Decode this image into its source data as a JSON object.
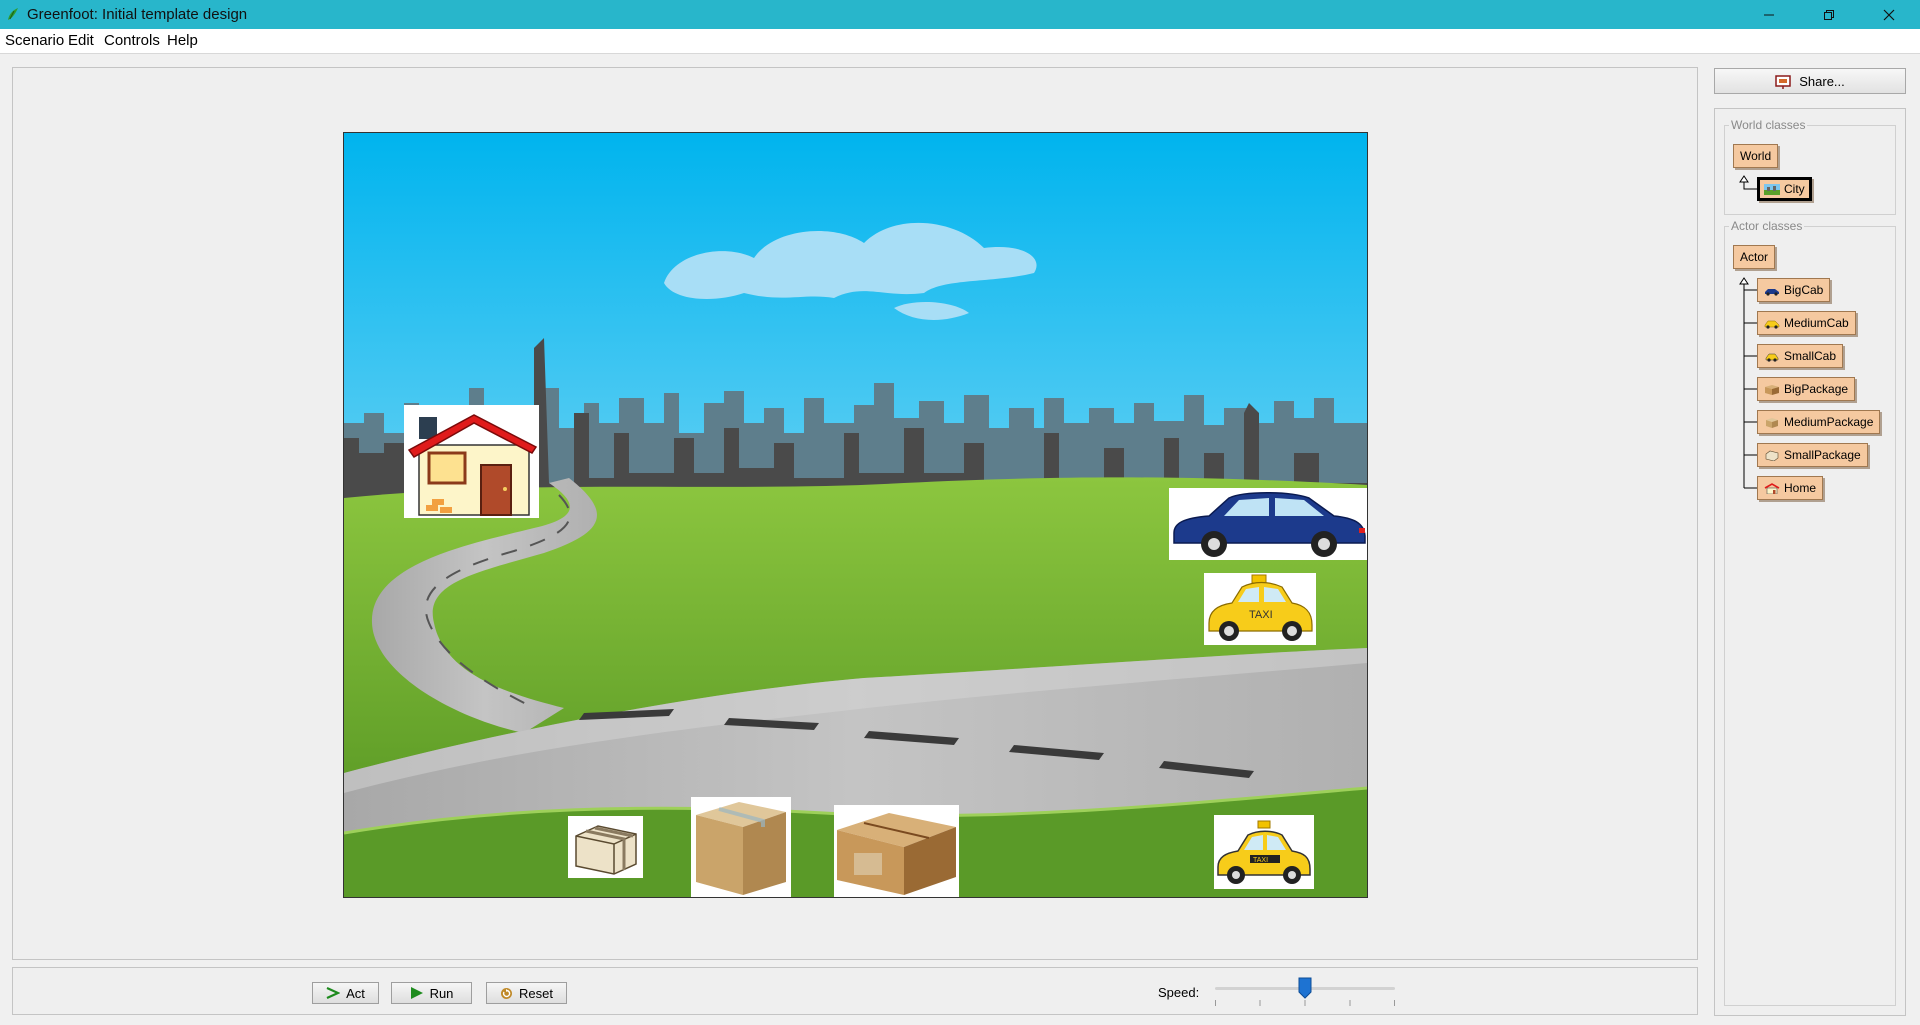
{
  "window": {
    "title": "Greenfoot: Initial template design",
    "accent_color": "#28b6cb"
  },
  "menu": [
    "Scenario",
    "Edit",
    "Controls",
    "Help"
  ],
  "world": {
    "background_icon": "city-skyline-road-scene",
    "actors": [
      {
        "name": "house-actor",
        "icon": "house-icon"
      },
      {
        "name": "blue-car-actor",
        "icon": "blue-car-icon"
      },
      {
        "name": "taxi-actor-medium",
        "icon": "taxi-icon",
        "label": "TAXI"
      },
      {
        "name": "small-package-actor",
        "icon": "wrapped-package-icon"
      },
      {
        "name": "medium-package-actor",
        "icon": "cardboard-box-icon"
      },
      {
        "name": "big-package-actor",
        "icon": "open-box-icon"
      },
      {
        "name": "taxi-actor-small",
        "icon": "taxi-icon",
        "label": "TAXI"
      }
    ]
  },
  "controls": {
    "act_label": "Act",
    "run_label": "Run",
    "reset_label": "Reset",
    "speed_label": "Speed:",
    "speed_value": 0.5
  },
  "class_panel": {
    "share_label": "Share...",
    "world_classes_label": "World classes",
    "world_classes": [
      {
        "label": "World",
        "icon": null,
        "selected": false
      },
      {
        "label": "City",
        "icon": "landscape-icon",
        "selected": true
      }
    ],
    "actor_classes_label": "Actor classes",
    "actor_classes": [
      {
        "label": "Actor",
        "icon": null
      },
      {
        "label": "BigCab",
        "icon": "blue-car-icon"
      },
      {
        "label": "MediumCab",
        "icon": "taxi-icon"
      },
      {
        "label": "SmallCab",
        "icon": "taxi-icon"
      },
      {
        "label": "BigPackage",
        "icon": "box-icon"
      },
      {
        "label": "MediumPackage",
        "icon": "box-icon"
      },
      {
        "label": "SmallPackage",
        "icon": "package-icon"
      },
      {
        "label": "Home",
        "icon": "house-icon"
      }
    ]
  }
}
